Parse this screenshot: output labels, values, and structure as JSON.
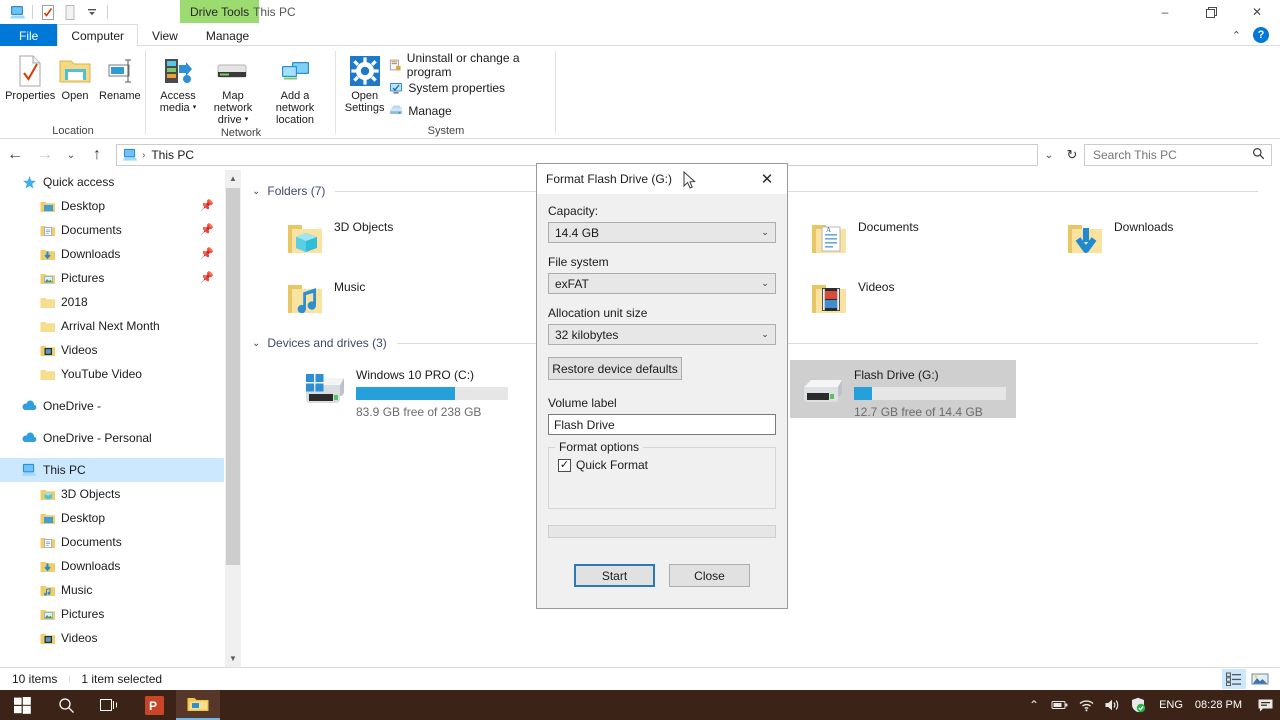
{
  "window": {
    "context_tab": "Drive Tools",
    "title": "This PC",
    "minimize": "–",
    "maximize": "❐",
    "close": "✕",
    "collapse_ribbon": "⌃",
    "help": "?"
  },
  "quick_access_toolbar": [
    {
      "name": "this-pc-icon",
      "glyph": "pc"
    },
    {
      "name": "properties-icon",
      "glyph": "props"
    },
    {
      "name": "new-folder-icon",
      "glyph": "newfolder"
    },
    {
      "name": "customize-dropdown-icon",
      "glyph": "caret"
    }
  ],
  "ribbon": {
    "tabs": [
      {
        "label": "File",
        "state": "file"
      },
      {
        "label": "Computer",
        "state": "active"
      },
      {
        "label": "View",
        "state": "normal"
      },
      {
        "label": "Manage",
        "state": "normal"
      }
    ],
    "groups": [
      {
        "label": "Location",
        "big_buttons": [
          {
            "label": "Properties",
            "icon": "properties-icon"
          },
          {
            "label": "Open",
            "icon": "open-folder-icon"
          },
          {
            "label": "Rename",
            "icon": "rename-icon"
          }
        ]
      },
      {
        "label": "Network",
        "big_buttons": [
          {
            "label": "Access media",
            "icon": "access-media-icon",
            "dropdown": true
          },
          {
            "label": "Map network drive",
            "icon": "map-network-drive-icon",
            "dropdown": true
          },
          {
            "label": "Add a network location",
            "icon": "add-network-location-icon"
          }
        ]
      },
      {
        "label": "System",
        "big_buttons": [
          {
            "label": "Open Settings",
            "icon": "settings-gear-icon"
          }
        ],
        "small_buttons": [
          {
            "label": "Uninstall or change a program",
            "icon": "uninstall-program-icon"
          },
          {
            "label": "System properties",
            "icon": "system-properties-icon"
          },
          {
            "label": "Manage",
            "icon": "manage-icon"
          }
        ]
      }
    ]
  },
  "addressbar": {
    "back": "←",
    "forward": "→",
    "recent": "⌄",
    "up": "↑",
    "breadcrumb_icon": "this-pc-icon",
    "breadcrumb_sep": "›",
    "breadcrumb": "This PC",
    "history_dropdown": "⌄",
    "refresh": "↻",
    "search_placeholder": "Search This PC",
    "search_value": "",
    "search_icon": "⌕"
  },
  "navpane": {
    "items": [
      {
        "label": "Quick access",
        "icon": "star-icon",
        "level": 0,
        "pinned": false,
        "selected": false
      },
      {
        "label": "Desktop",
        "icon": "desktop-folder-icon",
        "level": 1,
        "pinned": true,
        "selected": false
      },
      {
        "label": "Documents",
        "icon": "documents-folder-icon",
        "level": 1,
        "pinned": true,
        "selected": false
      },
      {
        "label": "Downloads",
        "icon": "downloads-folder-icon",
        "level": 1,
        "pinned": true,
        "selected": false
      },
      {
        "label": "Pictures",
        "icon": "pictures-folder-icon",
        "level": 1,
        "pinned": true,
        "selected": false
      },
      {
        "label": "2018",
        "icon": "folder-icon",
        "level": 1,
        "pinned": false,
        "selected": false
      },
      {
        "label": "Arrival Next Month",
        "icon": "folder-icon",
        "level": 1,
        "pinned": false,
        "selected": false
      },
      {
        "label": "Videos",
        "icon": "videos-folder-icon",
        "level": 1,
        "pinned": false,
        "selected": false
      },
      {
        "label": "YouTube Video",
        "icon": "folder-icon",
        "level": 1,
        "pinned": false,
        "selected": false
      },
      {
        "label": "OneDrive -",
        "icon": "onedrive-icon",
        "level": 0,
        "pinned": false,
        "selected": false
      },
      {
        "label": "OneDrive - Personal",
        "icon": "onedrive-icon",
        "level": 0,
        "pinned": false,
        "selected": false
      },
      {
        "label": "This PC",
        "icon": "this-pc-icon",
        "level": 0,
        "pinned": false,
        "selected": true
      },
      {
        "label": "3D Objects",
        "icon": "3d-objects-folder-icon",
        "level": 1,
        "pinned": false,
        "selected": false
      },
      {
        "label": "Desktop",
        "icon": "desktop-folder-icon",
        "level": 1,
        "pinned": false,
        "selected": false
      },
      {
        "label": "Documents",
        "icon": "documents-folder-icon",
        "level": 1,
        "pinned": false,
        "selected": false
      },
      {
        "label": "Downloads",
        "icon": "downloads-folder-icon",
        "level": 1,
        "pinned": false,
        "selected": false
      },
      {
        "label": "Music",
        "icon": "music-folder-icon",
        "level": 1,
        "pinned": false,
        "selected": false
      },
      {
        "label": "Pictures",
        "icon": "pictures-folder-icon",
        "level": 1,
        "pinned": false,
        "selected": false
      },
      {
        "label": "Videos",
        "icon": "videos-folder-icon",
        "level": 1,
        "pinned": false,
        "selected": false
      }
    ]
  },
  "content": {
    "folders_header": "Folders (7)",
    "drives_header": "Devices and drives (3)",
    "folders": [
      {
        "label": "3D Objects",
        "icon": "3d-objects-folder-icon",
        "col": 0,
        "row": 0
      },
      {
        "label": "Documents",
        "icon": "documents-folder-icon",
        "col": 1,
        "row": 0
      },
      {
        "label": "Downloads",
        "icon": "downloads-folder-icon",
        "col": 2,
        "row": 0
      },
      {
        "label": "Music",
        "icon": "music-folder-icon",
        "col": 0,
        "row": 1
      },
      {
        "label": "Videos",
        "icon": "videos-folder-icon",
        "col": 1,
        "row": 1
      }
    ],
    "drives": [
      {
        "name": "Windows 10 PRO (C:)",
        "icon": "windows-drive-icon",
        "free_text": "83.9 GB free of 238 GB",
        "used_percent": 65,
        "selected": false,
        "col": 0
      },
      {
        "name": "Flash Drive (G:)",
        "icon": "removable-drive-icon",
        "free_text": "12.7 GB free of 14.4 GB",
        "used_percent": 12,
        "selected": true,
        "col": 2
      }
    ]
  },
  "statusbar": {
    "item_count": "10 items",
    "selection": "1 item selected",
    "view_details_icon": "details-view-icon",
    "view_large_icons_icon": "large-icons-view-icon"
  },
  "dialog": {
    "title": "Format Flash Drive (G:)",
    "close": "✕",
    "capacity_label": "Capacity:",
    "capacity_value": "14.4 GB",
    "filesystem_label": "File system",
    "filesystem_value": "exFAT",
    "allocation_label": "Allocation unit size",
    "allocation_value": "32 kilobytes",
    "restore_defaults_label": "Restore device defaults",
    "volume_label_label": "Volume label",
    "volume_label_value": "Flash Drive",
    "format_options_label": "Format options",
    "quick_format_label": "Quick Format",
    "quick_format_checked": true,
    "quick_format_check_glyph": "✓",
    "start_label": "Start",
    "close_label": "Close",
    "combo_arrow": "⌄",
    "progress_value": 0
  },
  "taskbar": {
    "start_icon": "windows-start-icon",
    "search_icon": "search-icon",
    "taskview_icon": "task-view-icon",
    "apps": [
      {
        "name": "powerpoint-taskbar-icon",
        "label": "P",
        "active": false
      },
      {
        "name": "file-explorer-taskbar-icon",
        "label": "",
        "active": true
      }
    ],
    "tray": {
      "show_hidden_icon": "⌃",
      "battery_icon": "battery-icon",
      "wifi_icon": "wifi-icon",
      "volume_icon": "volume-icon",
      "security_icon": "security-shield-icon",
      "language": "ENG",
      "clock": "08:28 PM",
      "notifications_icon": "notifications-icon"
    }
  },
  "colors": {
    "accent": "#0078d7",
    "contextual_tab": "#9cdb70",
    "drive_bar": "#26a0da",
    "selection": "#cce8ff",
    "taskbar": "#3b2318"
  }
}
